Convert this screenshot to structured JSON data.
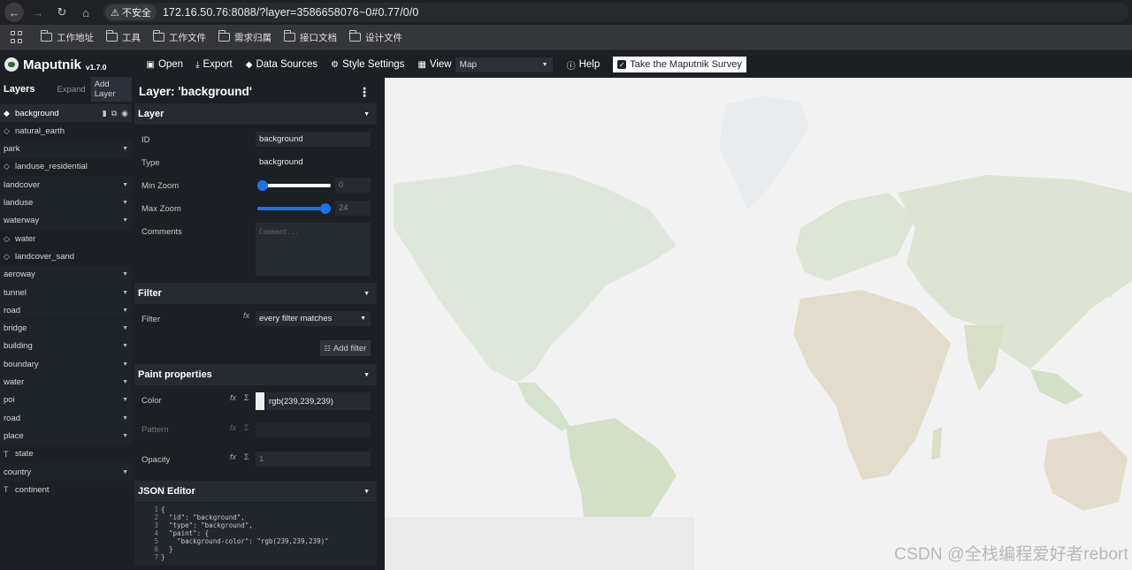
{
  "browser": {
    "security_label": "不安全",
    "url": "172.16.50.76:8088/?layer=3586658076~0#0.77/0/0",
    "bookmarks": [
      "工作地址",
      "工具",
      "工作文件",
      "需求归属",
      "接口文档",
      "设计文件"
    ]
  },
  "toolbar": {
    "app_name": "Maputnik",
    "version": "v1.7.0",
    "open": "Open",
    "export": "Export",
    "data_sources": "Data Sources",
    "style_settings": "Style Settings",
    "view": "View",
    "view_value": "Map",
    "help": "Help",
    "survey": "Take the Maputnik Survey"
  },
  "layers_panel": {
    "title": "Layers",
    "expand": "Expand",
    "add_layer": "Add Layer",
    "items": [
      {
        "label": "background",
        "kind": "layer",
        "selected": true
      },
      {
        "label": "natural_earth",
        "kind": "layer"
      },
      {
        "label": "park",
        "kind": "group"
      },
      {
        "label": "landuse_residential",
        "kind": "layer"
      },
      {
        "label": "landcover",
        "kind": "group"
      },
      {
        "label": "landuse",
        "kind": "group"
      },
      {
        "label": "waterway",
        "kind": "group"
      },
      {
        "label": "water",
        "kind": "layer"
      },
      {
        "label": "landcover_sand",
        "kind": "layer"
      },
      {
        "label": "aeroway",
        "kind": "group"
      },
      {
        "label": "tunnel",
        "kind": "group"
      },
      {
        "label": "road",
        "kind": "group"
      },
      {
        "label": "bridge",
        "kind": "group"
      },
      {
        "label": "building",
        "kind": "group"
      },
      {
        "label": "boundary",
        "kind": "group"
      },
      {
        "label": "water",
        "kind": "group"
      },
      {
        "label": "poi",
        "kind": "group"
      },
      {
        "label": "road",
        "kind": "group"
      },
      {
        "label": "place",
        "kind": "group"
      },
      {
        "label": "state",
        "kind": "symbol"
      },
      {
        "label": "country",
        "kind": "group"
      },
      {
        "label": "continent",
        "kind": "symbol"
      }
    ]
  },
  "editor": {
    "title": "Layer: 'background'",
    "layer_section": "Layer",
    "id_label": "ID",
    "id_value": "background",
    "type_label": "Type",
    "type_value": "background",
    "min_zoom_label": "Min Zoom",
    "min_zoom_value": "0",
    "min_zoom_fraction": 0,
    "max_zoom_label": "Max Zoom",
    "max_zoom_value": "24",
    "max_zoom_fraction": 1,
    "comments_label": "Comments",
    "comments_placeholder": "Comment...",
    "filter_section": "Filter",
    "filter_label": "Filter",
    "filter_value": "every filter matches",
    "add_filter": "Add filter",
    "paint_section": "Paint properties",
    "color_label": "Color",
    "color_value": "rgb(239,239,239)",
    "pattern_label": "Pattern",
    "opacity_label": "Opacity",
    "opacity_value": "1",
    "json_section": "JSON Editor",
    "json_lines": [
      "{",
      "  \"id\": \"background\",",
      "  \"type\": \"background\",",
      "  \"paint\": {",
      "    \"background-color\": \"rgb(239,239,239)\"",
      "  }",
      "}"
    ]
  },
  "map": {
    "watermark": "CSDN @全栈编程爱好者rebort"
  },
  "colors": {
    "accent": "#1a73e8",
    "panel": "#1c1f24",
    "section": "#262a31",
    "map_background": "#f2f2f2"
  }
}
